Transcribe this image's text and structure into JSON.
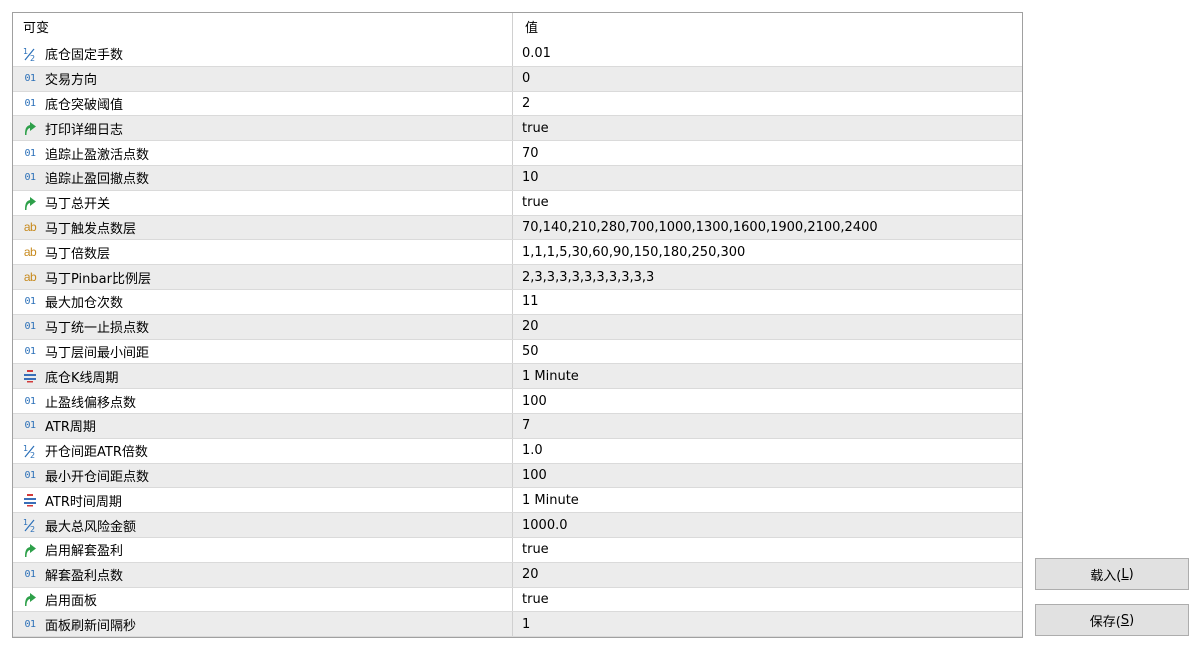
{
  "table": {
    "header": {
      "name": "可变",
      "value": "值"
    },
    "rows": [
      {
        "icon": "double",
        "name": "底仓固定手数",
        "value": "0.01"
      },
      {
        "icon": "int",
        "name": "交易方向",
        "value": "0"
      },
      {
        "icon": "int",
        "name": "底仓突破阈值",
        "value": "2"
      },
      {
        "icon": "bool",
        "name": "打印详细日志",
        "value": "true"
      },
      {
        "icon": "int",
        "name": "追踪止盈激活点数",
        "value": "70"
      },
      {
        "icon": "int",
        "name": "追踪止盈回撤点数",
        "value": "10"
      },
      {
        "icon": "bool",
        "name": "马丁总开关",
        "value": "true"
      },
      {
        "icon": "string",
        "name": "马丁触发点数层",
        "value": "70,140,210,280,700,1000,1300,1600,1900,2100,2400"
      },
      {
        "icon": "string",
        "name": "马丁倍数层",
        "value": "1,1,1,5,30,60,90,150,180,250,300"
      },
      {
        "icon": "string",
        "name": "马丁Pinbar比例层",
        "value": "2,3,3,3,3,3,3,3,3,3,3"
      },
      {
        "icon": "int",
        "name": "最大加仓次数",
        "value": "11"
      },
      {
        "icon": "int",
        "name": "马丁统一止损点数",
        "value": "20"
      },
      {
        "icon": "int",
        "name": "马丁层间最小间距",
        "value": "50"
      },
      {
        "icon": "enum",
        "name": "底仓K线周期",
        "value": "1 Minute"
      },
      {
        "icon": "int",
        "name": "止盈线偏移点数",
        "value": "100"
      },
      {
        "icon": "int",
        "name": "ATR周期",
        "value": "7"
      },
      {
        "icon": "double",
        "name": "开仓间距ATR倍数",
        "value": "1.0"
      },
      {
        "icon": "int",
        "name": "最小开仓间距点数",
        "value": "100"
      },
      {
        "icon": "enum",
        "name": "ATR时间周期",
        "value": "1 Minute"
      },
      {
        "icon": "double",
        "name": "最大总风险金额",
        "value": "1000.0"
      },
      {
        "icon": "bool",
        "name": "启用解套盈利",
        "value": "true"
      },
      {
        "icon": "int",
        "name": "解套盈利点数",
        "value": "20"
      },
      {
        "icon": "bool",
        "name": "启用面板",
        "value": "true"
      },
      {
        "icon": "int",
        "name": "面板刷新间隔秒",
        "value": "1"
      }
    ]
  },
  "icon_labels": {
    "int": "01",
    "string": "ab"
  },
  "buttons": {
    "load": {
      "label": "载入(",
      "accel": "L",
      "suffix": ")"
    },
    "save": {
      "label": "保存(",
      "accel": "S",
      "suffix": ")"
    }
  },
  "colors": {
    "int_icon": "#2a6fb8",
    "string_icon": "#c78a1e",
    "bool_icon": "#2ea04a",
    "enum_icon": "#d23a3a",
    "double_icon": "#2a6fb8",
    "alt_row": "#ececec"
  }
}
